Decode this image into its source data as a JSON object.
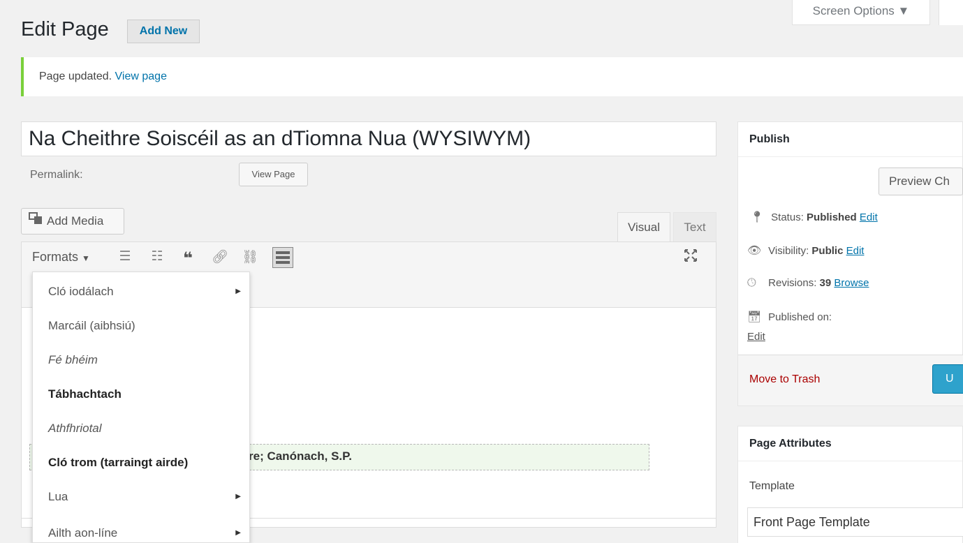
{
  "screen_options": {
    "label": "Screen Options ▼"
  },
  "header": {
    "title": "Edit Page",
    "add_new_label": "Add New"
  },
  "notice": {
    "text": "Page updated.",
    "link": "View page"
  },
  "post": {
    "title": "Na Cheithre Soiscéil as an dTiomna Nua (WYSIWYM)",
    "permalink_label": "Permalink:",
    "view_page_label": "View Page"
  },
  "editor": {
    "add_media_label": "Add Media",
    "tabs": {
      "visual": "Visual",
      "text": "Text"
    },
    "toolbar": {
      "formats_label": "Formats",
      "icons": [
        "bullet-list-icon",
        "numbered-list-icon",
        "blockquote-icon",
        "link-icon",
        "unlink-icon",
        "toolbar-toggle-icon",
        "fullscreen-icon"
      ]
    },
    "content": {
      "highlighted_text": "re; Canónach, S.P."
    }
  },
  "formats_menu": {
    "items": [
      {
        "label": "Cló iodálach",
        "style": "normal",
        "has_submenu": true
      },
      {
        "label": "Marcáil (aibhsiú)",
        "style": "normal",
        "has_submenu": false
      },
      {
        "label": "Fé bhéim",
        "style": "italic",
        "has_submenu": false
      },
      {
        "label": "Tábhachtach",
        "style": "bold",
        "has_submenu": false
      },
      {
        "label": "Athfhriotal",
        "style": "italic",
        "has_submenu": false
      },
      {
        "label": "Cló trom (tarraingt airde)",
        "style": "bold",
        "has_submenu": false
      },
      {
        "label": "Lua",
        "style": "normal",
        "has_submenu": true
      },
      {
        "label": "Ailth aon-líne",
        "style": "normal",
        "has_submenu": true
      }
    ]
  },
  "publish_box": {
    "title": "Publish",
    "preview_label": "Preview Ch",
    "status_label": "Status:",
    "status_value": "Published",
    "status_edit": "Edit",
    "visibility_label": "Visibility:",
    "visibility_value": "Public",
    "visibility_edit": "Edit",
    "revisions_label": "Revisions:",
    "revisions_value": "39",
    "revisions_browse": "Browse",
    "published_on_label": "Published on:",
    "published_on_edit": "Edit",
    "trash_label": "Move to Trash",
    "update_label": "U"
  },
  "page_attributes": {
    "title": "Page Attributes",
    "template_label": "Template",
    "template_value": "Front Page Template"
  },
  "colors": {
    "link": "#0073aa",
    "notice_border": "#7ad03a",
    "trash": "#aa0000",
    "primary_button": "#2ea2cc",
    "highlight_bg": "#eff8ec"
  }
}
